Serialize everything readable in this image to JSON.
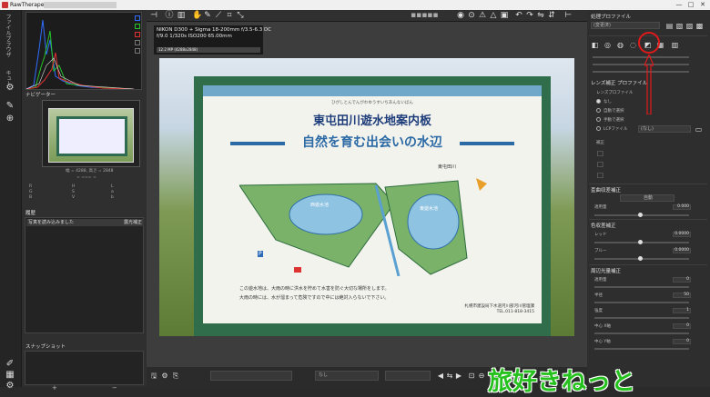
{
  "window": {
    "title": "RawTherapee 5.7 -",
    "controls": [
      "—",
      "□",
      "✕"
    ]
  },
  "vertical_tabs": {
    "file_browser": "ファイルブラウザ",
    "queue": "キュー"
  },
  "left_panel": {
    "navigator_label": "ナビゲーター",
    "nav_dims": "幅 = 4288, 高さ = 2848",
    "nav_info": "= === =",
    "history_label": "履歴",
    "history_item": "写真を読み込みました",
    "history_tag": "露光補正",
    "snapshot_label": "スナップショット",
    "snapshot_add": "+",
    "snapshot_remove": "−"
  },
  "photo_meta": {
    "camera": "NIKON D300 + Sigma 18-200mm f/3.5-6.3 DC",
    "exposure": "f/9.0  1/320s  ISO200  65.00mm",
    "size": "12.2 MP (4288x2848)"
  },
  "sign": {
    "furigana": "ひがしとんでんがわゆうすいちあんないばん",
    "title": "東屯田川遊水地案内板",
    "subtitle": "自然を育む出会いの水辺",
    "river_label": "東屯田川",
    "west_pond": "西遊水池",
    "east_pond": "東遊水池",
    "parking": "P",
    "body1": "この遊水地は、大雨の時に洪水を貯めて水害を防ぐ大切な場所をします。",
    "body2": "大雨の時には、水が溜まって危険ですので中には絶対入らないで下さい。",
    "owner": "札幌市建設局下水道河川部河川管理課",
    "tel": "TEL.011-818-3415"
  },
  "bottom_bar": {
    "zoom_field": "",
    "profile_field": "なし"
  },
  "right_panel": {
    "profile_label": "処理プロファイル",
    "profile_value": "(変更済)",
    "lens_section": "レンズ補正 プロファイル",
    "lens_profile": "レンズプロファイル",
    "lens_opts": [
      "なし",
      "自動で選択",
      "手動で選択",
      "LCPファイル"
    ],
    "lens_lcp_value": "(なし)",
    "correction_label": "補正",
    "distortion_section": "歪曲収差補正",
    "distortion_auto": "自動",
    "distortion_label": "適用量",
    "distortion_value": "0.000",
    "ca_section": "色収差補正",
    "ca_red": "レッド",
    "ca_red_value": "0.0000",
    "ca_blue": "ブルー",
    "ca_blue_value": "0.0000",
    "vig_section": "周辺光量補正",
    "vig_amount": "適用量",
    "vig_amount_value": "0",
    "vig_radius": "半径",
    "vig_radius_value": "50",
    "vig_strength": "強度",
    "vig_strength_value": "1",
    "vig_cx": "中心 X軸",
    "vig_cx_value": "0",
    "vig_cy": "中心 Y軸",
    "vig_cy_value": "0"
  },
  "watermark": "旅好きねっと",
  "colors": {
    "accent": "#e0191b",
    "watermark": "#27c11f",
    "board": "#2f6d4b"
  }
}
